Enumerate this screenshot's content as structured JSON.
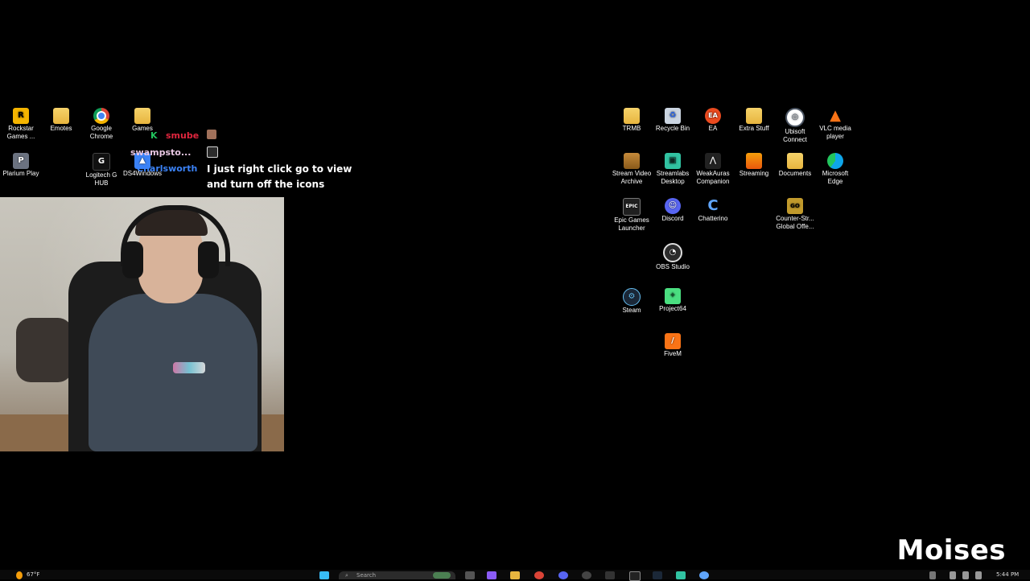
{
  "desktop": {
    "left_icons": [
      {
        "label": "Rockstar Games ...",
        "icon": "rockstar-icon",
        "color": "#f4b400"
      },
      {
        "label": "Emotes",
        "icon": "folder-icon",
        "color": "#e7b53f"
      },
      {
        "label": "Google Chrome",
        "icon": "chrome-icon",
        "color": "#db4437"
      },
      {
        "label": "Games",
        "icon": "folder-icon",
        "color": "#e7b53f"
      },
      {
        "label": "Plarium Play",
        "icon": "plarium-icon",
        "color": "#6b7280"
      },
      {
        "label": "Logitech G HUB",
        "icon": "logitech-icon",
        "color": "#111111"
      },
      {
        "label": "DS4Windows",
        "icon": "gamepad-icon",
        "color": "#3b82f6"
      }
    ],
    "right_icons": [
      {
        "label": "TRMB",
        "icon": "folder-icon",
        "color": "#e7b53f"
      },
      {
        "label": "Recycle Bin",
        "icon": "recycle-bin-icon",
        "color": "#cbd5e1"
      },
      {
        "label": "EA",
        "icon": "ea-icon",
        "color": "#ea4a1f"
      },
      {
        "label": "Extra Stuff",
        "icon": "folder-icon",
        "color": "#e7b53f"
      },
      {
        "label": "Ubisoft Connect",
        "icon": "ubisoft-icon",
        "color": "#4b5563"
      },
      {
        "label": "VLC media player",
        "icon": "vlc-icon",
        "color": "#f97316"
      },
      {
        "label": "Stream Video Archive",
        "icon": "folder-icon",
        "color": "#a16207"
      },
      {
        "label": "Streamlabs Desktop",
        "icon": "streamlabs-icon",
        "color": "#31c3a2"
      },
      {
        "label": "WeakAuras Companion",
        "icon": "weakauras-icon",
        "color": "#222222"
      },
      {
        "label": "Streaming",
        "icon": "folder-icon",
        "color": "#ea580c"
      },
      {
        "label": "Documents",
        "icon": "folder-icon",
        "color": "#e7b53f"
      },
      {
        "label": "Microsoft Edge",
        "icon": "edge-icon",
        "color": "#0ea5e9"
      },
      {
        "label": "Epic Games Launcher",
        "icon": "epic-icon",
        "color": "#1f1f1f"
      },
      {
        "label": "Discord",
        "icon": "discord-icon",
        "color": "#5865f2"
      },
      {
        "label": "Chatterino",
        "icon": "chatterino-icon",
        "color": "#60a5fa"
      },
      {
        "label": "Counter-Str... Global Offe...",
        "icon": "csgo-icon",
        "color": "#c19a2c"
      },
      {
        "label": "OBS Studio",
        "icon": "obs-icon",
        "color": "#2d2d2d"
      },
      {
        "label": "Steam",
        "icon": "steam-icon",
        "color": "#1b2838"
      },
      {
        "label": "Project64",
        "icon": "project64-icon",
        "color": "#4ade80"
      },
      {
        "label": "FiveM",
        "icon": "fivem-icon",
        "color": "#f97316"
      }
    ]
  },
  "chat": {
    "user1": "smube",
    "user1_prefix": "K",
    "user2": "swampsto...",
    "user3": "Charlsworth",
    "message": "I just right click go to view and turn off the icons"
  },
  "overlay": {
    "watermark": "Moises"
  },
  "taskbar": {
    "weather": "67°F",
    "search_placeholder": "Search",
    "clock": "5:44 PM"
  }
}
